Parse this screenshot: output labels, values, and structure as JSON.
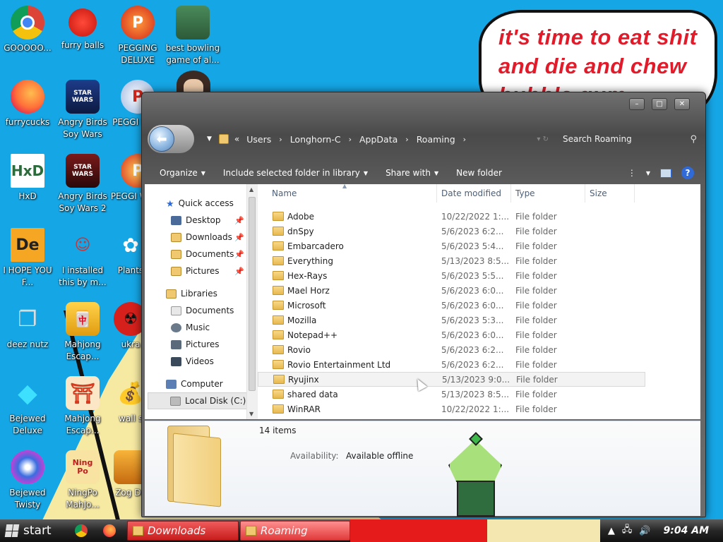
{
  "background": {
    "speech_bubble": [
      "it's time to eat shit",
      "and die and chew",
      "bubble gum"
    ]
  },
  "desktop_icons": [
    {
      "label": "GOOOOO...",
      "icon": "chrome-icon"
    },
    {
      "label": "furry balls",
      "icon": "furry-ball-icon"
    },
    {
      "label": "PEGGING DELUXE",
      "icon": "peggle-icon"
    },
    {
      "label": "best bowling game of al...",
      "icon": "bowling-santa-icon"
    },
    {
      "label": "furrycucks",
      "icon": "firefox-icon"
    },
    {
      "label": "Angry Birds Soy Wars",
      "icon": "angry-birds-star-wars-icon"
    },
    {
      "label": "PEGGI NIGH",
      "icon": "peggle-nights-icon"
    },
    {
      "label": "HxD",
      "icon": "hxd-icon"
    },
    {
      "label": "Angry Birds Soy Wars 2",
      "icon": "angry-birds-star-wars-2-icon"
    },
    {
      "label": "PEGGI WARC",
      "icon": "peggle-icon"
    },
    {
      "label": "I HOPE YOU F...",
      "icon": "de-icon"
    },
    {
      "label": "I installed this by m...",
      "icon": "character-icon"
    },
    {
      "label": "Plants",
      "icon": "plants-icon"
    },
    {
      "label": "deez nutz",
      "icon": "windows-stack-icon"
    },
    {
      "label": "Mahjong Escap...",
      "icon": "mahjong-icon"
    },
    {
      "label": "ukra",
      "icon": "radiation-icon"
    },
    {
      "label": "Bejewed Deluxe",
      "icon": "diamond-icon"
    },
    {
      "label": "Mahjong Escap...",
      "icon": "torii-icon"
    },
    {
      "label": "wall s",
      "icon": "money-bag-icon"
    },
    {
      "label": "Bejewed Twisty",
      "icon": "twist-gem-icon"
    },
    {
      "label": "NingPo MahJo...",
      "icon": "ningpo-icon"
    },
    {
      "label": "Zog Da",
      "icon": "zog-icon"
    }
  ],
  "explorer": {
    "caption": {
      "minimize": "–",
      "maximize": "□",
      "close": "✕"
    },
    "breadcrumb": {
      "overflow": "«",
      "items": [
        "Users",
        "Longhorn-C",
        "AppData",
        "Roaming"
      ]
    },
    "search_placeholder": "Search Roaming",
    "toolbar": {
      "organize": "Organize",
      "include": "Include selected folder in library",
      "share": "Share with",
      "new_folder": "New folder"
    },
    "nav": {
      "quick_access": "Quick access",
      "pinned": [
        "Desktop",
        "Downloads",
        "Documents",
        "Pictures"
      ],
      "libraries": "Libraries",
      "library_items": [
        "Documents",
        "Music",
        "Pictures",
        "Videos"
      ],
      "computer": "Computer",
      "local_disk": "Local Disk (C:)"
    },
    "columns": {
      "name": "Name",
      "date": "Date modified",
      "type": "Type",
      "size": "Size"
    },
    "files": [
      {
        "name": "Adobe",
        "date": "10/22/2022 1:...",
        "type": "File folder"
      },
      {
        "name": "dnSpy",
        "date": "5/6/2023 6:2...",
        "type": "File folder"
      },
      {
        "name": "Embarcadero",
        "date": "5/6/2023 5:4...",
        "type": "File folder"
      },
      {
        "name": "Everything",
        "date": "5/13/2023 8:5...",
        "type": "File folder"
      },
      {
        "name": "Hex-Rays",
        "date": "5/6/2023 5:5...",
        "type": "File folder"
      },
      {
        "name": "Mael Horz",
        "date": "5/6/2023 6:0...",
        "type": "File folder"
      },
      {
        "name": "Microsoft",
        "date": "5/6/2023 6:0...",
        "type": "File folder"
      },
      {
        "name": "Mozilla",
        "date": "5/6/2023 5:3...",
        "type": "File folder"
      },
      {
        "name": "Notepad++",
        "date": "5/6/2023 6:0...",
        "type": "File folder"
      },
      {
        "name": "Rovio",
        "date": "5/6/2023 6:2...",
        "type": "File folder"
      },
      {
        "name": "Rovio Entertainment Ltd",
        "date": "5/6/2023 6:2...",
        "type": "File folder"
      },
      {
        "name": "Ryujinx",
        "date": "5/13/2023 9:0...",
        "type": "File folder"
      },
      {
        "name": "shared data",
        "date": "5/13/2023 8:5...",
        "type": "File folder"
      },
      {
        "name": "WinRAR",
        "date": "10/22/2022 1:...",
        "type": "File folder"
      }
    ],
    "details": {
      "count": "14 items",
      "availability_label": "Availability:",
      "availability_value": "Available offline"
    }
  },
  "taskbar": {
    "start": "start",
    "tasks": [
      "Downloads",
      "Roaming"
    ],
    "clock": "9:04 AM"
  }
}
